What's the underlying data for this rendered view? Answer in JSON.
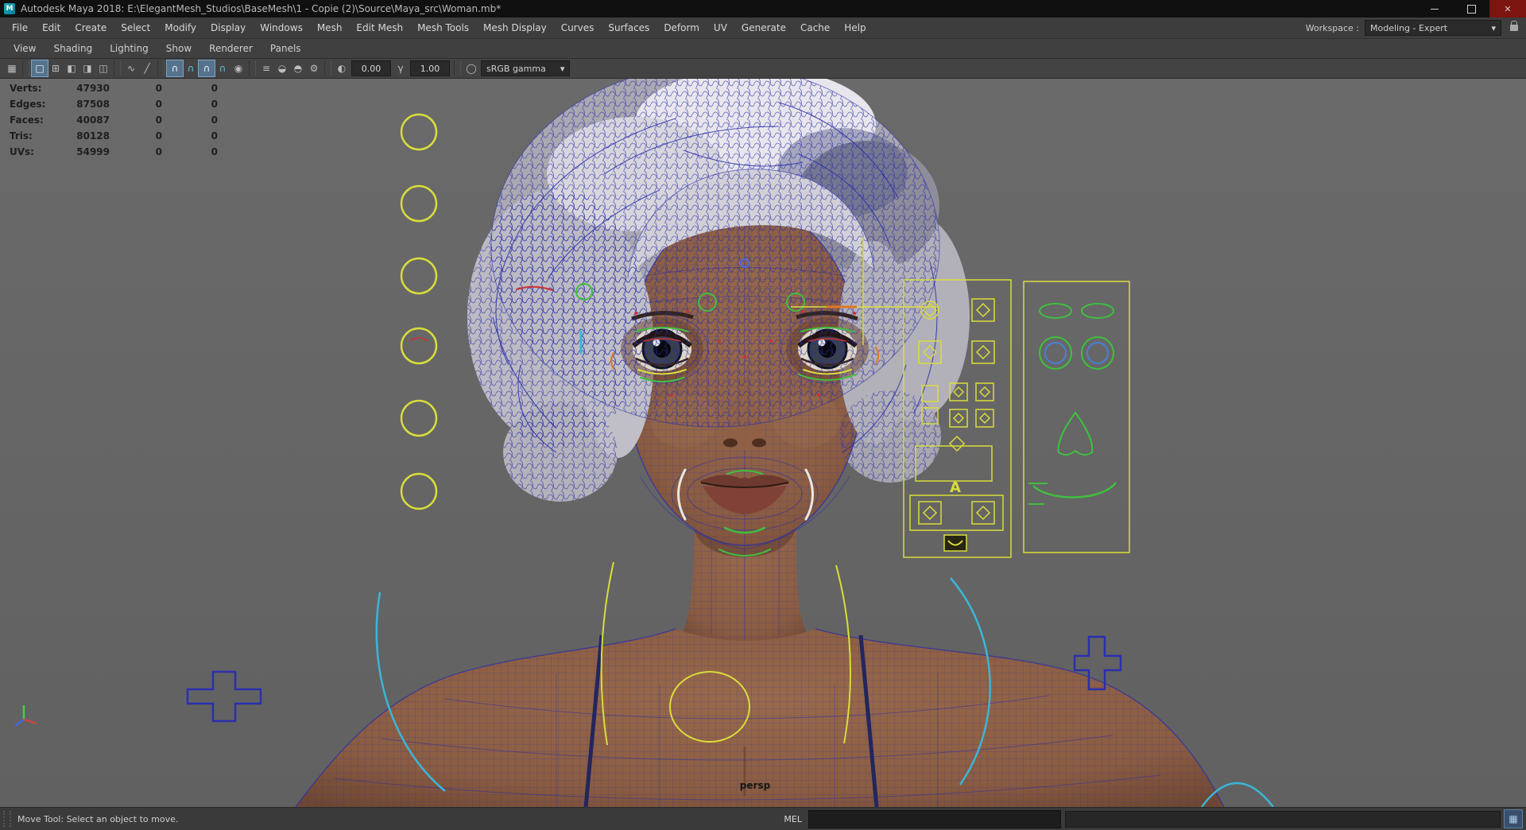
{
  "window": {
    "logo_glyph": "M",
    "title": "Autodesk Maya 2018: E:\\ElegantMesh_Studios\\BaseMesh\\1 - Copie (2)\\Source\\Maya_src\\Woman.mb*",
    "controls": {
      "close": "✕"
    }
  },
  "menubar": {
    "items": [
      "File",
      "Edit",
      "Create",
      "Select",
      "Modify",
      "Display",
      "Windows",
      "Mesh",
      "Edit Mesh",
      "Mesh Tools",
      "Mesh Display",
      "Curves",
      "Surfaces",
      "Deform",
      "UV",
      "Generate",
      "Cache",
      "Help"
    ]
  },
  "workspace": {
    "label": "Workspace :",
    "value": "Modeling - Expert",
    "arrow": "▾"
  },
  "panel_menubar": {
    "items": [
      "View",
      "Shading",
      "Lighting",
      "Show",
      "Renderer",
      "Panels"
    ]
  },
  "toolbar": {
    "icons": [
      "▦",
      "□",
      "⊞",
      "◧",
      "◨",
      "◫",
      "∿",
      "╱",
      "∩",
      "∩",
      "∩",
      "∩",
      "◉",
      "≡",
      "◒",
      "◓",
      "⚙",
      "◐",
      "γ",
      "◯"
    ],
    "exposure_value": "0.00",
    "gamma_value": "1.00",
    "colorspace": "sRGB gamma",
    "arrow": "▾"
  },
  "hud": {
    "rows": [
      {
        "label": "Verts:",
        "total": "47930",
        "a": "0",
        "b": "0"
      },
      {
        "label": "Edges:",
        "total": "87508",
        "a": "0",
        "b": "0"
      },
      {
        "label": "Faces:",
        "total": "40087",
        "a": "0",
        "b": "0"
      },
      {
        "label": "Tris:",
        "total": "80128",
        "a": "0",
        "b": "0"
      },
      {
        "label": "UVs:",
        "total": "54999",
        "a": "0",
        "b": "0"
      }
    ]
  },
  "viewport": {
    "camera": "persp",
    "rig_label": "A"
  },
  "statusbar": {
    "help": "Move Tool: Select an object to move.",
    "mel": "MEL"
  },
  "colors": {
    "viewport_bg": "#6a6a6a",
    "wire": "#272cab",
    "skin": "#8a5c41",
    "hair": "#b0aeb6",
    "accent_yellow": "#d9dd3a",
    "rig_green": "#3fbf3f",
    "rig_cyan": "#3ab6d8",
    "rig_blue": "#2a2fae",
    "hud_text": "#1e1e1e"
  }
}
